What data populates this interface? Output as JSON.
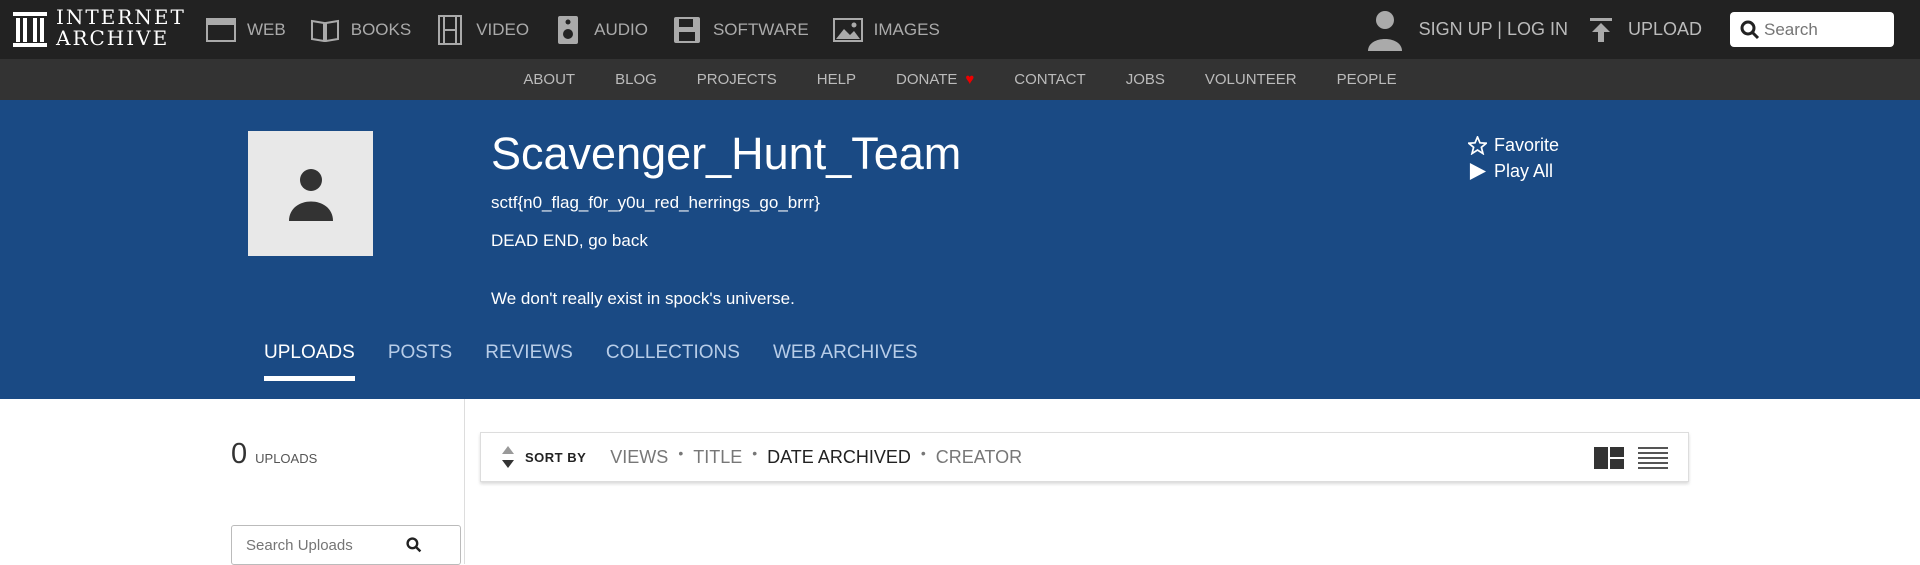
{
  "header": {
    "logo_line1": "INTERNET",
    "logo_line2": "ARCHIVE",
    "media": [
      {
        "label": "WEB",
        "icon": "web-icon"
      },
      {
        "label": "BOOKS",
        "icon": "book-icon"
      },
      {
        "label": "VIDEO",
        "icon": "film-icon"
      },
      {
        "label": "AUDIO",
        "icon": "speaker-icon"
      },
      {
        "label": "SOFTWARE",
        "icon": "floppy-icon"
      },
      {
        "label": "IMAGES",
        "icon": "image-icon"
      }
    ],
    "signup_label": "SIGN UP | LOG IN",
    "upload_label": "UPLOAD",
    "search_placeholder": "Search"
  },
  "subnav": {
    "items": [
      "ABOUT",
      "BLOG",
      "PROJECTS",
      "HELP",
      "DONATE",
      "CONTACT",
      "JOBS",
      "VOLUNTEER",
      "PEOPLE"
    ]
  },
  "profile": {
    "username": "Scavenger_Hunt_Team",
    "flag_text": "sctf{n0_flag_f0r_y0u_red_herrings_go_brrr}",
    "desc_line1": "DEAD END, go back",
    "desc_line2": "We don't really exist in spock's universe.",
    "favorite_label": "Favorite",
    "playall_label": "Play All",
    "tabs": [
      "UPLOADS",
      "POSTS",
      "REVIEWS",
      "COLLECTIONS",
      "WEB ARCHIVES"
    ],
    "active_tab": "UPLOADS"
  },
  "content": {
    "upload_count": "0",
    "upload_count_label": "UPLOADS",
    "search_uploads_placeholder": "Search Uploads",
    "sort_by_label": "SORT BY",
    "sort_options": [
      "VIEWS",
      "TITLE",
      "DATE ARCHIVED",
      "CREATOR"
    ],
    "active_sort": "DATE ARCHIVED"
  },
  "colors": {
    "topbar": "#222222",
    "subnav": "#333333",
    "banner": "#1a4a84",
    "heart": "#ee0000"
  }
}
